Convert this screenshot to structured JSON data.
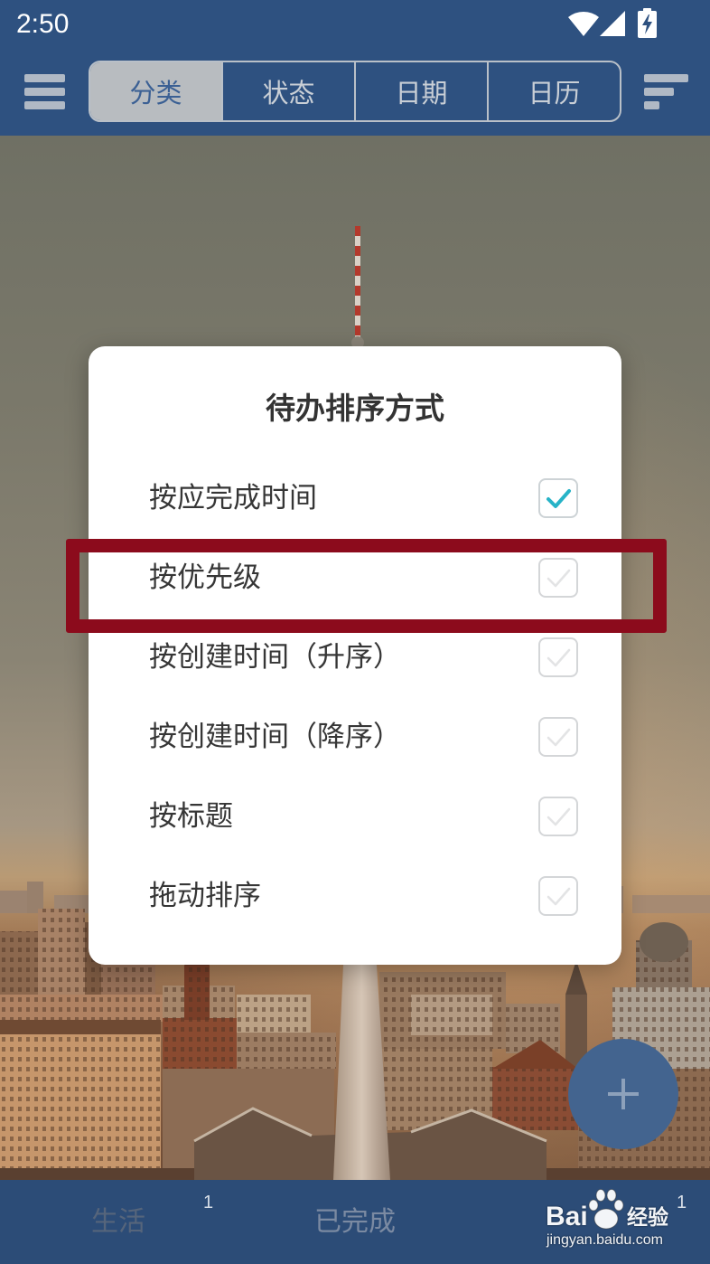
{
  "status_bar": {
    "time": "2:50",
    "icons": {
      "wifi": "wifi-icon",
      "signal": "cell-signal-icon",
      "battery": "battery-charging-icon"
    }
  },
  "header": {
    "menu_icon": "hamburger-menu-icon",
    "tabs": [
      {
        "label": "分类",
        "selected": true
      },
      {
        "label": "状态",
        "selected": false
      },
      {
        "label": "日期",
        "selected": false
      },
      {
        "label": "日历",
        "selected": false
      }
    ],
    "sort_icon": "sort-icon"
  },
  "dialog": {
    "title": "待办排序方式",
    "options": [
      {
        "label": "按应完成时间",
        "checked": true,
        "highlighted": false
      },
      {
        "label": "按优先级",
        "checked": false,
        "highlighted": true
      },
      {
        "label": "按创建时间（升序）",
        "checked": false,
        "highlighted": false
      },
      {
        "label": "按创建时间（降序）",
        "checked": false,
        "highlighted": false
      },
      {
        "label": "按标题",
        "checked": false,
        "highlighted": false
      },
      {
        "label": "拖动排序",
        "checked": false,
        "highlighted": false
      }
    ]
  },
  "fab": {
    "icon": "plus-icon"
  },
  "bottom_nav": {
    "tabs": [
      {
        "label": "生活",
        "badge": "1"
      },
      {
        "label": "已完成"
      },
      {
        "badge": "1"
      }
    ]
  },
  "watermark": {
    "brand_latin": "Bai",
    "brand_cn": "经验",
    "url": "jingyan.baidu.com",
    "icon": "paw-icon"
  },
  "colors": {
    "header_bg": "#2e5180",
    "accent_check": "#27b3c7",
    "annotation_red": "#8c0b1c",
    "fab_bg": "#43648f",
    "bottom_bar_bg": "#2c4c77"
  }
}
